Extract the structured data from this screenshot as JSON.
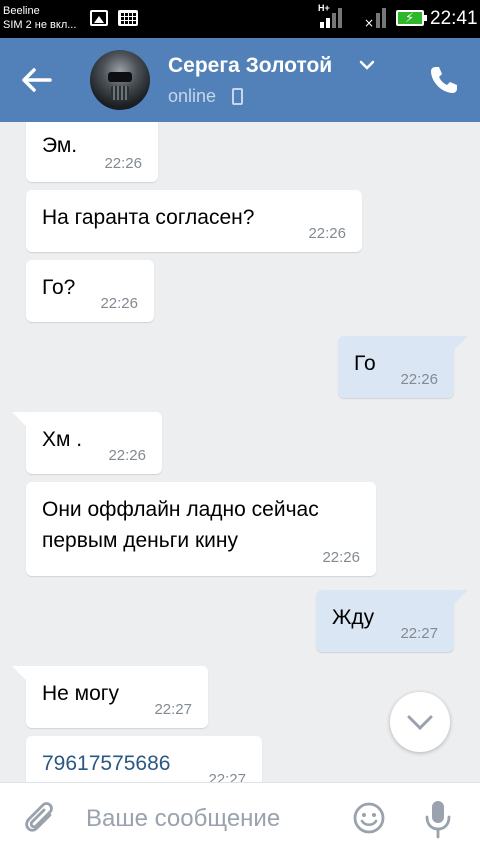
{
  "status_bar": {
    "carrier_line1": "Beeline",
    "carrier_line2": "SIM 2 не вкл...",
    "network": "H+",
    "time": "22:41"
  },
  "header": {
    "contact_name": "Серега Золотой",
    "status": "online"
  },
  "messages": [
    {
      "dir": "in",
      "text": "Эм.",
      "time": "22:26"
    },
    {
      "dir": "in",
      "text": "На гаранта согласен?",
      "time": "22:26"
    },
    {
      "dir": "in",
      "text": "Го?",
      "time": "22:26"
    },
    {
      "dir": "out",
      "text": "Го",
      "time": "22:26"
    },
    {
      "dir": "in",
      "text": "Хм .",
      "time": "22:26"
    },
    {
      "dir": "in",
      "text": "Они оффлайн ладно сейчас первым деньги кину",
      "time": "22:26"
    },
    {
      "dir": "out",
      "text": "Жду",
      "time": "22:27"
    },
    {
      "dir": "in",
      "text": "Не могу",
      "time": "22:27"
    },
    {
      "dir": "in",
      "text": "79617575686",
      "time": "22:27",
      "is_link": true
    }
  ],
  "composer": {
    "placeholder": "Ваше сообщение"
  },
  "colors": {
    "header_bg": "#5181b8",
    "chat_bg": "#edeef0",
    "incoming_bubble": "#ffffff",
    "outgoing_bubble": "#dbe6f4",
    "link": "#2a5885",
    "battery": "#2fb72a"
  },
  "icons": [
    "back-arrow-icon",
    "chevron-down-icon",
    "phone-icon",
    "call-icon",
    "scroll-down-chevron-icon",
    "paperclip-icon",
    "emoji-icon",
    "microphone-icon"
  ]
}
